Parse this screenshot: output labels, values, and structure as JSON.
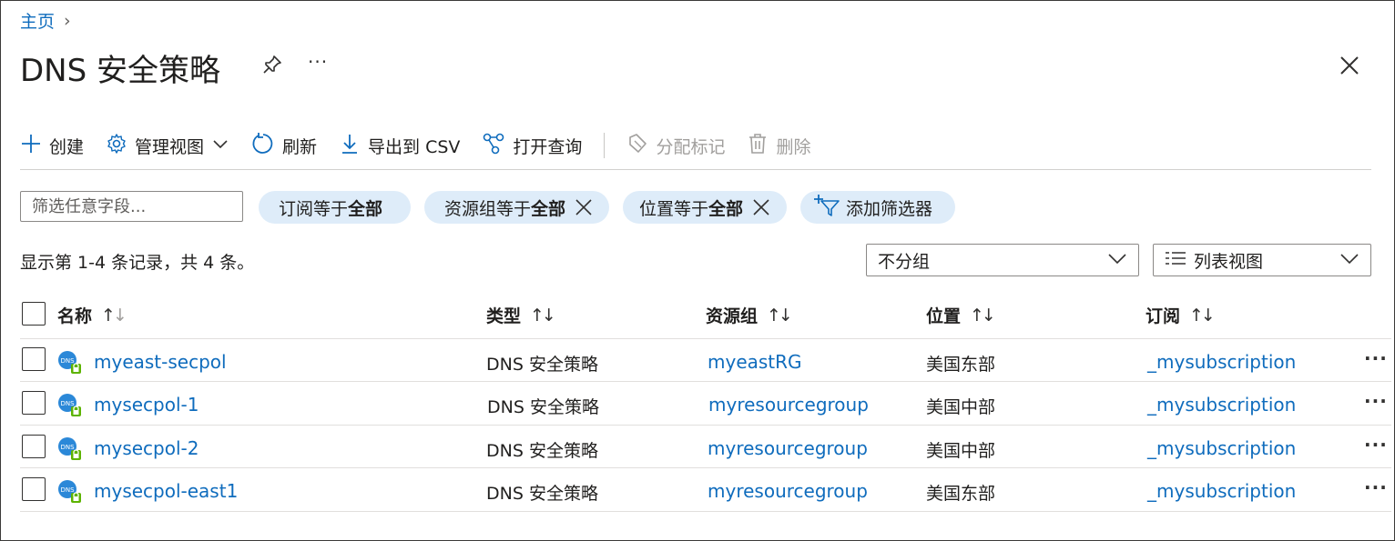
{
  "breadcrumb": {
    "home": "主页",
    "separator": "›"
  },
  "title": "DNS 安全策略",
  "title_more": "···",
  "toolbar": {
    "create": "创建",
    "manage_view": "管理视图",
    "refresh": "刷新",
    "export_csv": "导出到 CSV",
    "open_query": "打开查询",
    "assign_tags": "分配标记",
    "delete": "删除"
  },
  "filters": {
    "placeholder": "筛选任意字段...",
    "subscription": {
      "label": "订阅等于 ",
      "value": "全部"
    },
    "resource_group": {
      "label": "资源组等于 ",
      "value": "全部"
    },
    "location": {
      "label": "位置等于 ",
      "value": "全部"
    },
    "add_filter": "添加筛选器"
  },
  "record_count": "显示第 1-4 条记录，共 4 条。",
  "grouping": {
    "selected": "不分组"
  },
  "view": {
    "selected": "列表视图"
  },
  "columns": {
    "name": "名称",
    "type": "类型",
    "resource_group": "资源组",
    "location": "位置",
    "subscription": "订阅"
  },
  "rows": [
    {
      "name": "myeast-secpol",
      "type": "DNS 安全策略",
      "resource_group": "myeastRG",
      "location": "美国东部",
      "subscription": "_mysubscription"
    },
    {
      "name": "mysecpol-1",
      "type": "DNS 安全策略",
      "resource_group": "myresourcegroup",
      "location": "美国中部",
      "subscription": "_mysubscription"
    },
    {
      "name": "mysecpol-2",
      "type": "DNS 安全策略",
      "resource_group": "myresourcegroup",
      "location": "美国中部",
      "subscription": "_mysubscription"
    },
    {
      "name": "mysecpol-east1",
      "type": "DNS 安全策略",
      "resource_group": "myresourcegroup",
      "location": "美国东部",
      "subscription": "_mysubscription"
    }
  ],
  "row_more": "···",
  "colors": {
    "link": "#0f6cbd",
    "pill": "#deecf9",
    "disabled": "#a19f9d"
  },
  "icons": [
    "chevron-right-icon",
    "pin-icon",
    "close-icon",
    "plus-icon",
    "gear-icon",
    "chevron-down-icon",
    "refresh-icon",
    "download-icon",
    "query-icon",
    "tag-icon",
    "trash-icon",
    "dismiss-icon",
    "add-filter-icon",
    "list-view-icon",
    "dns-icon"
  ]
}
